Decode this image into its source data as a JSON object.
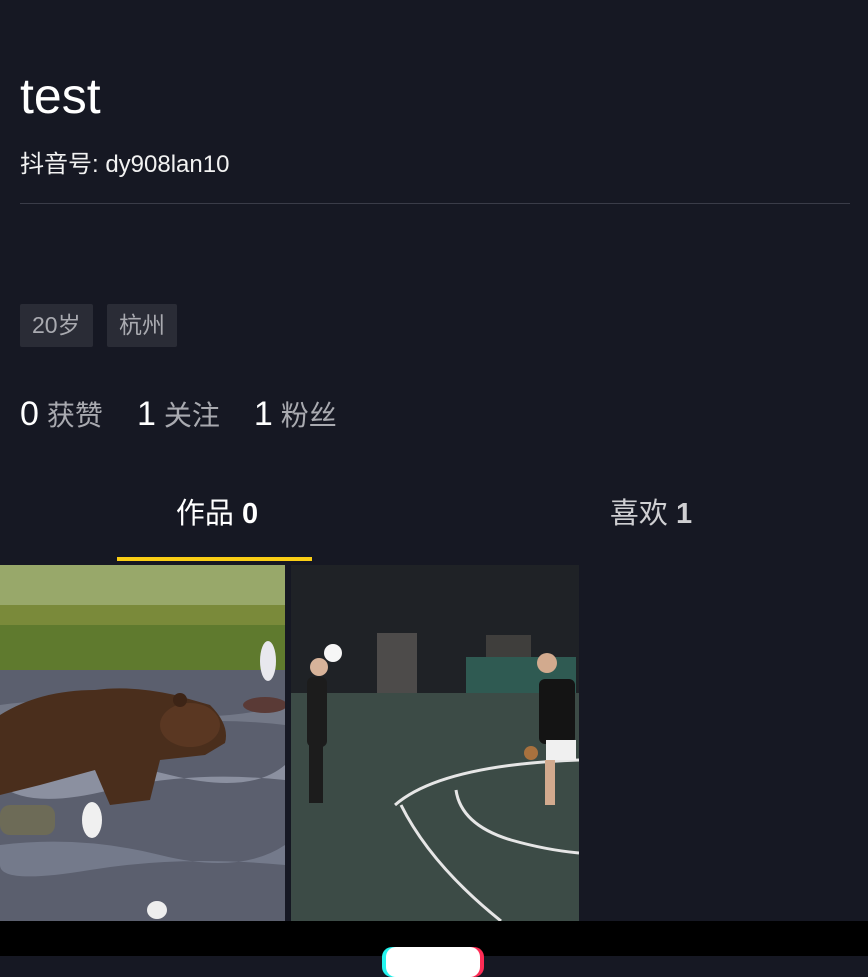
{
  "profile": {
    "name": "test",
    "douyin_id": "抖音号: dy908lan10",
    "tags": [
      "20岁",
      "杭州"
    ],
    "stats": [
      {
        "value": "0",
        "label": "获赞"
      },
      {
        "value": "1",
        "label": "关注"
      },
      {
        "value": "1",
        "label": "粉丝"
      }
    ]
  },
  "tabs": [
    {
      "label": "作品",
      "count": "0"
    },
    {
      "label": "喜欢",
      "count": "1"
    }
  ],
  "videos": [
    {
      "subject": "bear-in-river"
    },
    {
      "subject": "night-basketball-court"
    }
  ],
  "colors": {
    "background": "#161823",
    "accent": "#face15",
    "muted_text": "#a9aab0"
  }
}
